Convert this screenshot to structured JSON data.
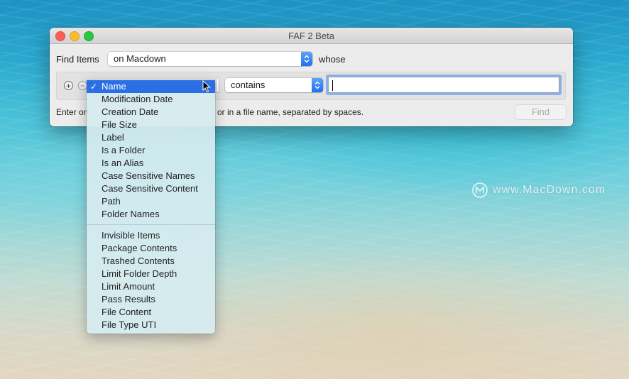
{
  "watermark": {
    "text": "www.MacDown.com"
  },
  "window": {
    "title": "FAF 2 Beta",
    "find_items_label": "Find Items",
    "location_value": "on Macdown",
    "whose_label": "whose",
    "criteria": {
      "attribute_value": "Name",
      "operator_value": "contains",
      "search_value": ""
    },
    "help_text_left": "Enter on",
    "help_text_right": "or in a file name, separated by spaces.",
    "find_button": "Find"
  },
  "menu": {
    "selected": "Name",
    "group1": [
      "Name",
      "Modification Date",
      "Creation Date",
      "File Size",
      "Label",
      "Is a Folder",
      "Is an Alias",
      "Case Sensitive Names",
      "Case Sensitive Content",
      "Path",
      "Folder Names"
    ],
    "group2": [
      "Invisible Items",
      "Package Contents",
      "Trashed Contents",
      "Limit Folder Depth",
      "Limit Amount",
      "Pass Results",
      "File Content",
      "File Type UTI"
    ]
  },
  "colors": {
    "accent": "#2c6fe5",
    "close": "#fc5f57",
    "minimize": "#fdbc2e",
    "maximize": "#28c840"
  },
  "icons": {
    "add": "plus-circle-icon",
    "remove": "minus-circle-icon",
    "popup": "chevron-updown-icon",
    "cursor": "mouse-pointer-icon"
  }
}
